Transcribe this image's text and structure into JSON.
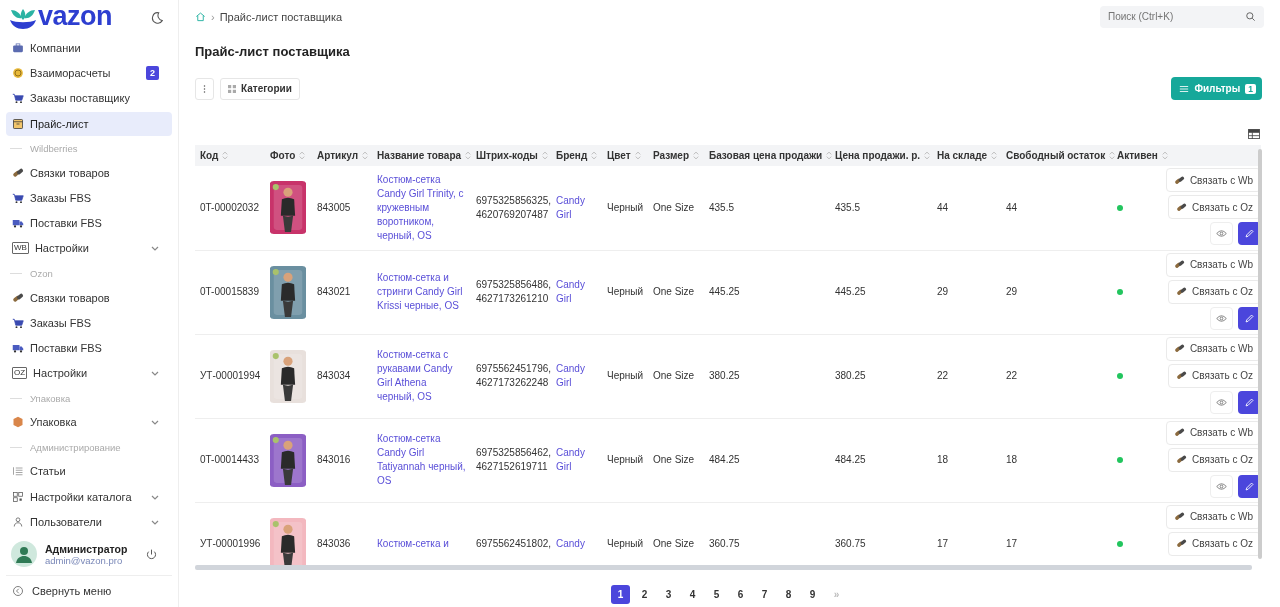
{
  "logo": {
    "text": "vazon"
  },
  "sidebar": {
    "items": [
      {
        "kind": "item",
        "label": "Компании",
        "selected": false
      },
      {
        "kind": "item",
        "label": "Взаиморасчеты",
        "selected": false,
        "badge": "2"
      },
      {
        "kind": "item",
        "label": "Заказы поставщику",
        "selected": false
      },
      {
        "kind": "item",
        "label": "Прайс-лист",
        "selected": true
      },
      {
        "kind": "section",
        "label": "Wildberries"
      },
      {
        "kind": "item",
        "label": "Связки товаров",
        "selected": false
      },
      {
        "kind": "item",
        "label": "Заказы FBS",
        "selected": false
      },
      {
        "kind": "item",
        "label": "Поставки FBS",
        "selected": false
      },
      {
        "kind": "item",
        "label": "Настройки",
        "selected": false,
        "tag": "WB",
        "expanded": false
      },
      {
        "kind": "section",
        "label": "Ozon"
      },
      {
        "kind": "item",
        "label": "Связки товаров",
        "selected": false
      },
      {
        "kind": "item",
        "label": "Заказы FBS",
        "selected": false
      },
      {
        "kind": "item",
        "label": "Поставки FBS",
        "selected": false
      },
      {
        "kind": "item",
        "label": "Настройки",
        "selected": false,
        "tag": "OZ",
        "expanded": false
      },
      {
        "kind": "section",
        "label": "Упаковка"
      },
      {
        "kind": "item",
        "label": "Упаковка",
        "selected": false,
        "expanded": false
      },
      {
        "kind": "section",
        "label": "Администрирование"
      },
      {
        "kind": "item",
        "label": "Статьи",
        "selected": false
      },
      {
        "kind": "item",
        "label": "Настройки каталога",
        "selected": false,
        "expanded": false
      },
      {
        "kind": "item",
        "label": "Пользователи",
        "selected": false,
        "expanded": false
      }
    ]
  },
  "user": {
    "name": "Администратор",
    "email": "admin@vazon.pro"
  },
  "collapse_menu": "Свернуть меню",
  "breadcrumb": {
    "separator": "›",
    "items": [
      "Прайс-лист поставщика"
    ]
  },
  "search": {
    "placeholder": "Поиск (Ctrl+K)"
  },
  "title": "Прайс-лист поставщика",
  "toolbar": {
    "categories": "Категории",
    "filters": "Фильтры",
    "filter_count": "1"
  },
  "table": {
    "columns": [
      "Код",
      "Фото",
      "Артикул",
      "Название товара",
      "Штрих-коды",
      "Бренд",
      "Цвет",
      "Размер",
      "Базовая цена продажи",
      "Цена продажи. р.",
      "На складе",
      "Свободный остаток",
      "Активен"
    ],
    "rows": [
      {
        "code": "0T-00002032",
        "article": "843005",
        "name": "Костюм-сетка Candy Girl Trinity, с кружевным воротником, черный, OS",
        "barcodes": "6975325856325, 4620769207487",
        "brand": "Candy Girl",
        "color_name": "Черный",
        "size": "One Size",
        "base_price": "435.5",
        "price": "435.5",
        "stock": "44",
        "free": "44",
        "active": true,
        "actions": [
          "Связать с Wb",
          "Связать с Oz"
        ],
        "icon_buttons": true
      },
      {
        "code": "0T-00015839",
        "article": "843021",
        "name": "Костюм-сетка и стринги Candy Girl Krissi черные, OS",
        "barcodes": "6975325856486, 4627173261210",
        "brand": "Candy Girl",
        "color_name": "Черный",
        "size": "One Size",
        "base_price": "445.25",
        "price": "445.25",
        "stock": "29",
        "free": "29",
        "active": true,
        "actions": [
          "Связать с Wb",
          "Связать с Oz"
        ],
        "icon_buttons": true
      },
      {
        "code": "УТ-00001994",
        "article": "843034",
        "name": "Костюм-сетка с рукавами Candy Girl Athena черный, OS",
        "barcodes": "6975562451796, 4627173262248",
        "brand": "Candy Girl",
        "color_name": "Черный",
        "size": "One Size",
        "base_price": "380.25",
        "price": "380.25",
        "stock": "22",
        "free": "22",
        "active": true,
        "actions": [
          "Связать с Wb",
          "Связать с Oz"
        ],
        "icon_buttons": true
      },
      {
        "code": "0T-00014433",
        "article": "843016",
        "name": "Костюм-сетка Candy Girl Tatiyannah черный, OS",
        "barcodes": "6975325856462, 4627152619711",
        "brand": "Candy Girl",
        "color_name": "Черный",
        "size": "One Size",
        "base_price": "484.25",
        "price": "484.25",
        "stock": "18",
        "free": "18",
        "active": true,
        "actions": [
          "Связать с Wb",
          "Связать с Oz"
        ],
        "icon_buttons": true
      },
      {
        "code": "УТ-00001996",
        "article": "843036",
        "name": "Костюм-сетка и",
        "barcodes": "6975562451802,",
        "brand": "Candy",
        "color_name": "Черный",
        "size": "One Size",
        "base_price": "360.75",
        "price": "360.75",
        "stock": "17",
        "free": "17",
        "active": true,
        "actions": [
          "Связать с Wb",
          "Связать с Oz"
        ],
        "icon_buttons": false
      }
    ]
  },
  "pagination": {
    "pages": [
      {
        "label": "1",
        "selected": true
      },
      {
        "label": "2",
        "selected": false
      },
      {
        "label": "3",
        "selected": false
      },
      {
        "label": "4",
        "selected": false
      },
      {
        "label": "5",
        "selected": false
      },
      {
        "label": "6",
        "selected": false
      },
      {
        "label": "7",
        "selected": false
      },
      {
        "label": "8",
        "selected": false
      },
      {
        "label": "9",
        "selected": false
      }
    ],
    "next": "»"
  }
}
